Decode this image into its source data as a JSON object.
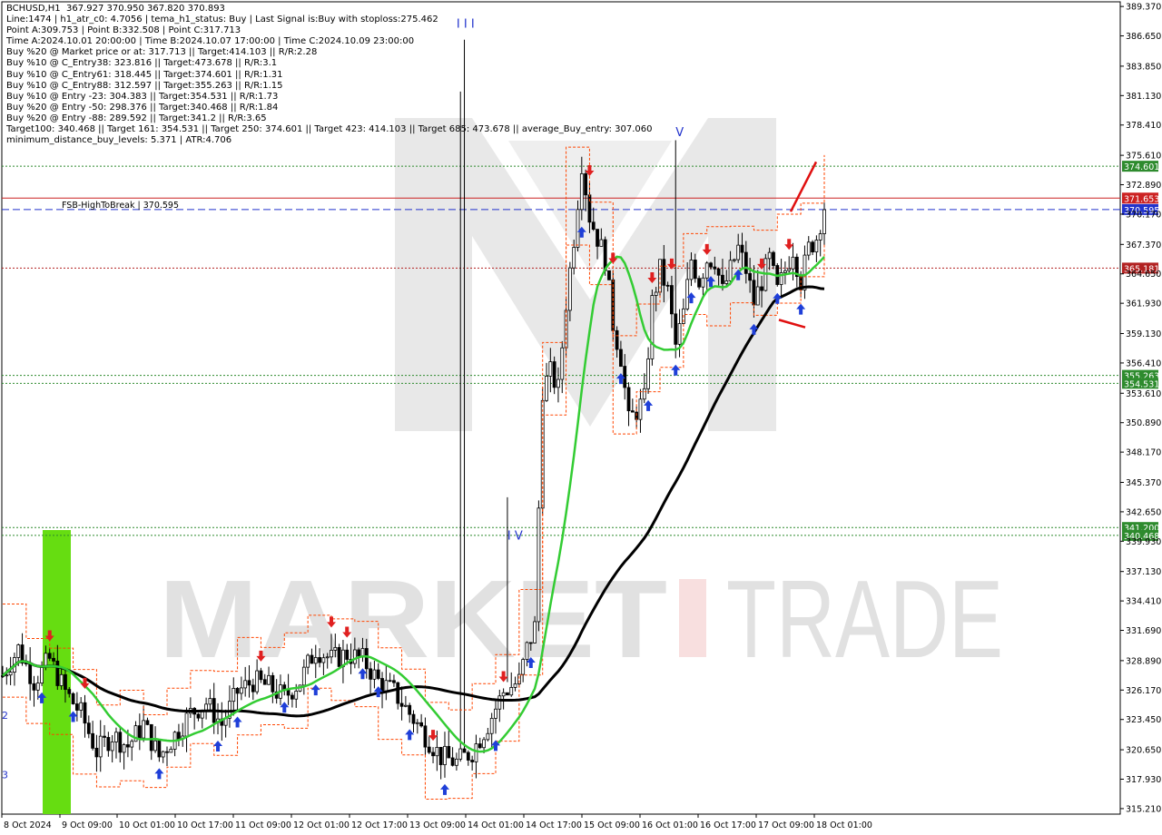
{
  "chart_data": {
    "type": "candlestick",
    "symbol": "BCHUSD",
    "timeframe": "H1",
    "title": "BCHUSD,H1  367.927 370.950 367.820 370.893",
    "ohlc_header": {
      "open": 367.927,
      "high": 370.95,
      "low": 367.82,
      "close": 370.893
    },
    "info_lines": [
      "BCHUSD,H1  367.927 370.950 367.820 370.893",
      "Line:1474 | h1_atr_c0: 4.7056 | tema_h1_status: Buy | Last Signal is:Buy with stoploss:275.462",
      "Point A:309.753 | Point B:332.508 | Point C:317.713",
      "Time A:2024.10.01 20:00:00 | Time B:2024.10.07 17:00:00 | Time C:2024.10.09 23:00:00",
      "Buy %20 @ Market price or at: 317.713 || Target:414.103 || R/R:2.28",
      "Buy %10 @ C_Entry38: 323.816 || Target:473.678 || R/R:3.1",
      "Buy %10 @ C_Entry61: 318.445 || Target:374.601 || R/R:1.31",
      "Buy %10 @ C_Entry88: 312.597 || Target:355.263 || R/R:1.15",
      "Buy %10 @ Entry -23: 304.383 || Target:354.531 || R/R:1.73",
      "Buy %20 @ Entry -50: 298.376 || Target:340.468 || R/R:1.84",
      "Buy %20 @ Entry -88: 289.592 || Target:341.2 || R/R:3.65",
      "Target100: 340.468 || Target 161: 354.531 || Target 250: 374.601 || Target 423: 414.103 || Target 685: 473.678 || average_Buy_entry: 307.060",
      "minimum_distance_buy_levels: 5.371 | ATR:4.706"
    ],
    "y_ticks": [
      389.37,
      386.65,
      383.85,
      381.13,
      378.41,
      375.61,
      372.89,
      370.17,
      367.37,
      364.65,
      361.93,
      359.13,
      356.41,
      353.61,
      350.89,
      348.17,
      345.37,
      342.65,
      339.93,
      337.13,
      334.41,
      331.69,
      328.89,
      326.17,
      323.45,
      320.65,
      317.93,
      315.21
    ],
    "ylim": [
      314.7,
      389.8
    ],
    "x_ticks": [
      "8 Oct 2024",
      "9 Oct 09:00",
      "10 Oct 01:00",
      "10 Oct 17:00",
      "11 Oct 09:00",
      "12 Oct 01:00",
      "12 Oct 17:00",
      "13 Oct 09:00",
      "14 Oct 01:00",
      "14 Oct 17:00",
      "15 Oct 09:00",
      "16 Oct 01:00",
      "16 Oct 17:00",
      "17 Oct 09:00",
      "18 Oct 01:00"
    ],
    "levels": [
      {
        "label": "374.601",
        "value": 374.601,
        "color": "#2e8b2e",
        "style": "dotted"
      },
      {
        "label": "371.653",
        "value": 371.653,
        "color": "#cc2222",
        "style": "solid"
      },
      {
        "label": "370.595",
        "value": 370.595,
        "color": "#2233cc",
        "style": "dashed",
        "name": "FSB-HighToBreak | 370.595"
      },
      {
        "label": "365.181",
        "value": 365.181,
        "color": "#b22222",
        "style": "dotted"
      },
      {
        "label": "355.263",
        "value": 355.263,
        "color": "#2e8b2e",
        "style": "dotted"
      },
      {
        "label": "354.531",
        "value": 354.531,
        "color": "#2e8b2e",
        "style": "dotted"
      },
      {
        "label": "341.200",
        "value": 341.2,
        "color": "#2e8b2e",
        "style": "dotted"
      },
      {
        "label": "340.468",
        "value": 340.468,
        "color": "#2e8b2e",
        "style": "dotted"
      }
    ],
    "wave_labels": [
      {
        "text": "I I I",
        "x_candle": 116,
        "price": 387.4
      },
      {
        "text": "V",
        "x_candle": 172,
        "price": 377.4
      },
      {
        "text": "I V",
        "x_candle": 129,
        "price": 340.1
      },
      {
        "text": "2",
        "x_candle": 0,
        "price": 323.5
      },
      {
        "text": "3",
        "x_candle": 0,
        "price": 318.0
      }
    ],
    "watermark": "MARKETZ TRADE",
    "colors": {
      "bull": "#2e8b57",
      "bear": "#000000",
      "ma_fast": "#33cc33",
      "ma_slow": "#000000",
      "envelope": "#ff4500",
      "buy_arrow": "#1f3fd8",
      "sell_arrow": "#e02020",
      "highlight": "#66dd11"
    }
  }
}
